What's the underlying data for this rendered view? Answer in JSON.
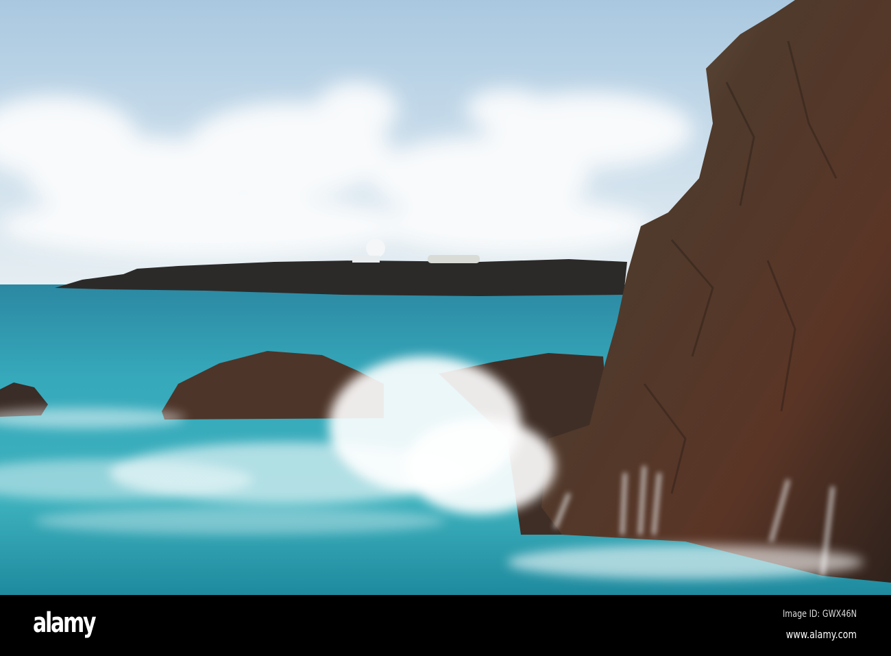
{
  "watermark": {
    "logo": "alamy",
    "image_id": "Image ID: GWX46N",
    "url": "www.alamy.com"
  },
  "colors": {
    "sky_top": "#b3cfe4",
    "horizon": "#e4edf2",
    "sea_far": "#2a8ea6",
    "sea_near": "#38b0bd",
    "rock": "#4a3328",
    "spray": "#ffffff"
  }
}
